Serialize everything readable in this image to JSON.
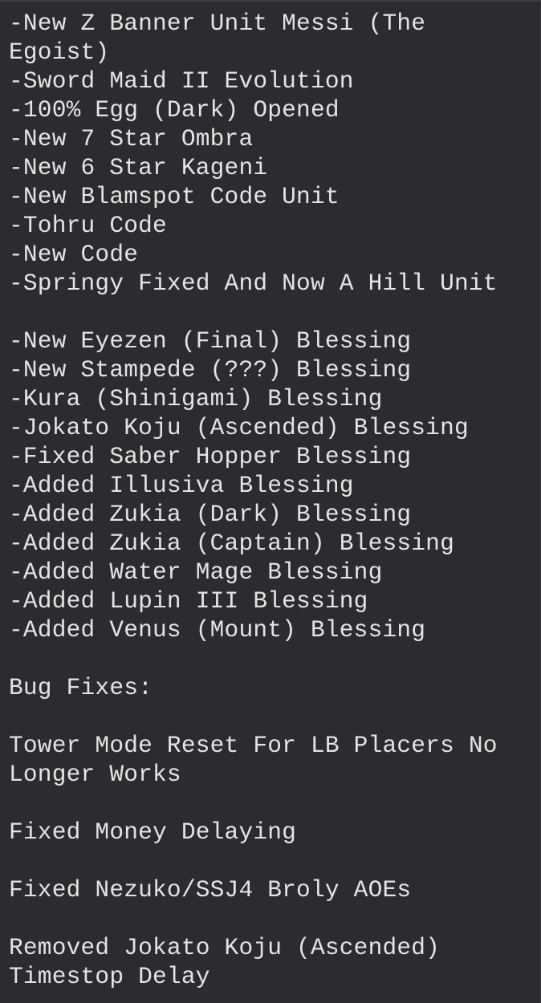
{
  "colors": {
    "background": "#2b2c30",
    "text": "#e4e4e4"
  },
  "updates": [
    "-New Z Banner Unit Messi (The Egoist)",
    "-Sword Maid II Evolution",
    "-100% Egg (Dark) Opened",
    "-New 7 Star Ombra",
    "-New 6 Star Kageni",
    "-New Blamspot Code Unit",
    "-Tohru Code",
    "-New Code",
    "-Springy Fixed And Now A Hill Unit"
  ],
  "blessings": [
    "-New Eyezen (Final) Blessing",
    "-New Stampede (???) Blessing",
    "-Kura (Shinigami) Blessing",
    "-Jokato Koju (Ascended) Blessing",
    "-Fixed Saber Hopper Blessing",
    "-Added Illusiva Blessing",
    "-Added Zukia (Dark) Blessing",
    "-Added Zukia (Captain) Blessing",
    "-Added Water Mage Blessing",
    "-Added Lupin III Blessing",
    "-Added Venus (Mount) Blessing"
  ],
  "bug_fixes": {
    "heading": "Bug Fixes:",
    "items": [
      "Tower Mode Reset For LB Placers No Longer Works",
      "Fixed Money Delaying",
      "Fixed Nezuko/SSJ4 Broly AOEs",
      "Removed Jokato Koju (Ascended) Timestop Delay"
    ]
  }
}
